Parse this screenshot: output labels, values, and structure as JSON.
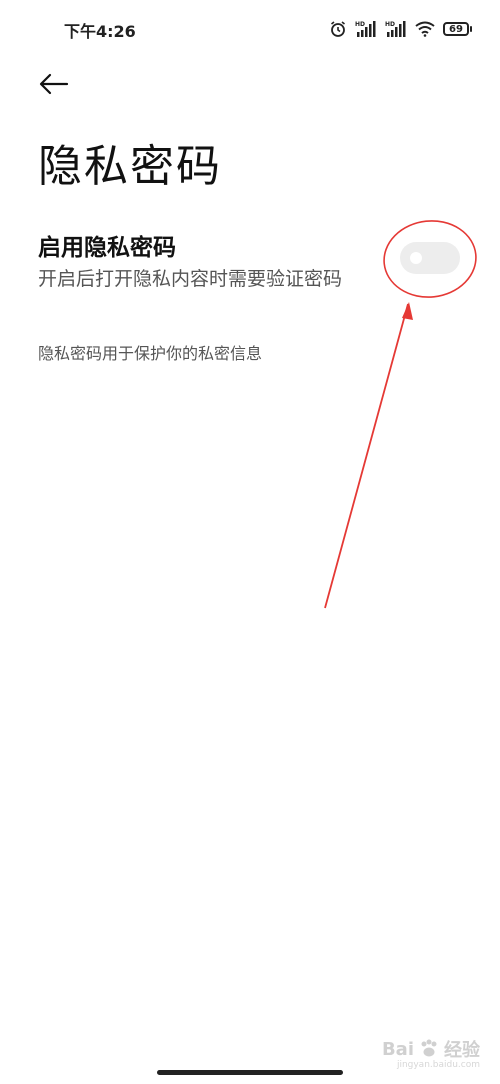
{
  "status_bar": {
    "time": "下午4:26",
    "battery": "69",
    "icons": [
      "alarm-icon",
      "hd-signal-icon",
      "hd-signal-icon",
      "wifi-icon",
      "battery-icon"
    ]
  },
  "header": {
    "back_icon": "back-arrow-icon",
    "title": "隐私密码"
  },
  "setting": {
    "title": "启用隐私密码",
    "description": "开启后打开隐私内容时需要验证密码",
    "toggle_on": false
  },
  "info": {
    "text": "隐私密码用于保护你的私密信息"
  },
  "watermark": {
    "brand": "Bai",
    "brand2": "经验",
    "url": "jingyan.baidu.com"
  },
  "colors": {
    "annotation": "#e53935",
    "toggle_off": "#ededed"
  }
}
